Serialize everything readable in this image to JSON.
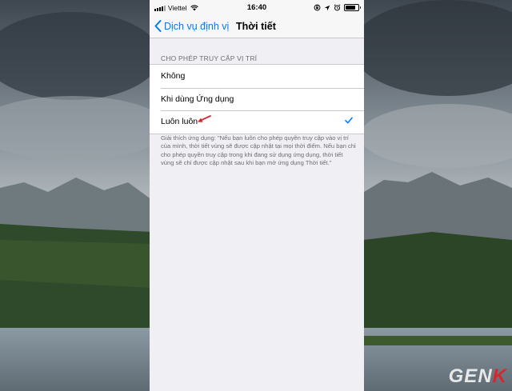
{
  "status_bar": {
    "carrier": "Viettel",
    "time": "16:40"
  },
  "nav": {
    "back_label": "Dịch vụ định vị",
    "title": "Thời tiết"
  },
  "location_access": {
    "header": "CHO PHÉP TRUY CẬP VỊ TRÍ",
    "options": [
      {
        "label": "Không",
        "selected": false
      },
      {
        "label": "Khi dùng Ứng dụng",
        "selected": false
      },
      {
        "label": "Luôn luôn",
        "selected": true
      }
    ],
    "explanation": "Giải thích ứng dụng: \"Nếu bạn luôn cho phép quyền truy cập vào vị trí của mình, thời tiết vùng sẽ được cập nhật tại mọi thời điểm. Nếu bạn chỉ cho phép quyền truy cập trong khi đang sử dụng ứng dụng, thời tiết vùng sẽ chỉ được cập nhật sau khi bạn mở ứng dụng Thời tiết.\""
  },
  "watermark": {
    "text_main": "GEN",
    "text_accent": "K"
  },
  "colors": {
    "accent": "#007aff",
    "annotation_arrow": "#d9262c",
    "watermark_accent": "#d9262c"
  }
}
